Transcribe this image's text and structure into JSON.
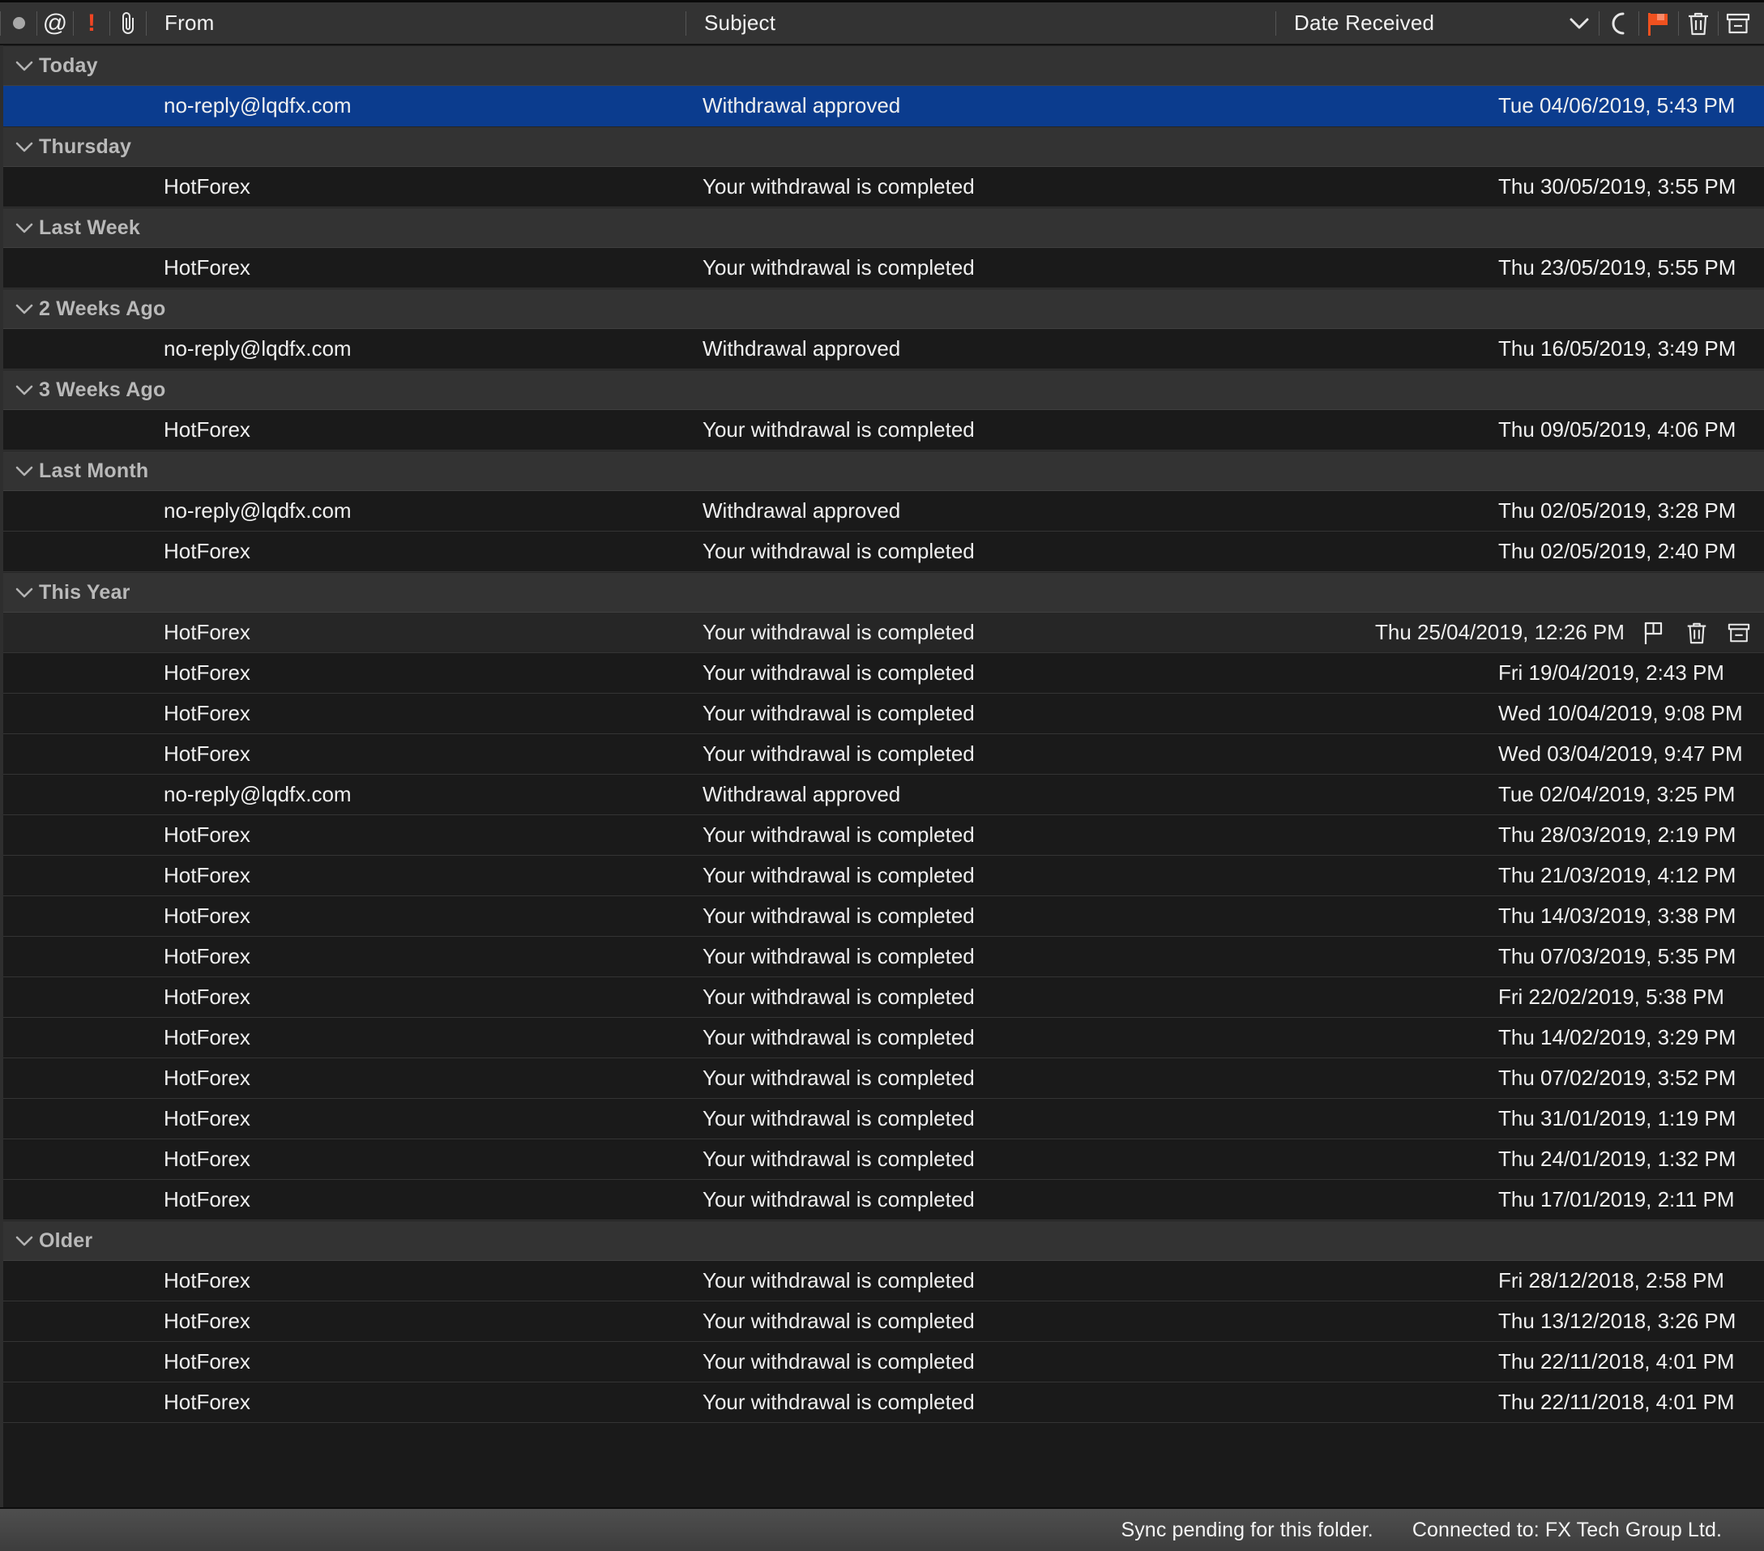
{
  "columns": {
    "icon_columns": [
      {
        "name": "unread-dot",
        "glyph": "●"
      },
      {
        "name": "mention-at",
        "glyph": "@"
      },
      {
        "name": "priority-exclaim",
        "glyph": "!"
      },
      {
        "name": "attachment-paperclip",
        "glyph": "🖇"
      }
    ],
    "from_label": "From",
    "subject_label": "Subject",
    "date_label": "Date Received"
  },
  "header_actions": [
    {
      "name": "chevron-down-icon",
      "label": "Sort direction"
    },
    {
      "name": "unread-moon-icon",
      "label": "Mark unread"
    },
    {
      "name": "flag-icon",
      "label": "Flag"
    },
    {
      "name": "trash-icon",
      "label": "Delete"
    },
    {
      "name": "archive-icon",
      "label": "Archive"
    }
  ],
  "colors": {
    "selection": "#0b3c8e",
    "flag_orange": "#f0511f",
    "priority_orange": "#ef4523",
    "group_header_bg": "#333333",
    "row_bg": "#1a1a1a",
    "hover_bg": "#262626",
    "statusbar_bg": "#474747"
  },
  "groups": [
    {
      "title": "Today",
      "rows": [
        {
          "from": "no-reply@lqdfx.com",
          "subject": "Withdrawal approved",
          "date": "Tue 04/06/2019, 5:43 PM",
          "selected": true,
          "hover": false
        }
      ]
    },
    {
      "title": "Thursday",
      "rows": [
        {
          "from": "HotForex",
          "subject": "Your withdrawal is completed",
          "date": "Thu 30/05/2019, 3:55 PM",
          "selected": false,
          "hover": false
        }
      ]
    },
    {
      "title": "Last Week",
      "rows": [
        {
          "from": "HotForex",
          "subject": "Your withdrawal is completed",
          "date": "Thu 23/05/2019, 5:55 PM",
          "selected": false,
          "hover": false
        }
      ]
    },
    {
      "title": "2 Weeks Ago",
      "rows": [
        {
          "from": "no-reply@lqdfx.com",
          "subject": "Withdrawal approved",
          "date": "Thu 16/05/2019, 3:49 PM",
          "selected": false,
          "hover": false
        }
      ]
    },
    {
      "title": "3 Weeks Ago",
      "rows": [
        {
          "from": "HotForex",
          "subject": "Your withdrawal is completed",
          "date": "Thu 09/05/2019, 4:06 PM",
          "selected": false,
          "hover": false
        }
      ]
    },
    {
      "title": "Last Month",
      "rows": [
        {
          "from": "no-reply@lqdfx.com",
          "subject": "Withdrawal approved",
          "date": "Thu 02/05/2019, 3:28 PM",
          "selected": false,
          "hover": false
        },
        {
          "from": "HotForex",
          "subject": "Your withdrawal is completed",
          "date": "Thu 02/05/2019, 2:40 PM",
          "selected": false,
          "hover": false
        }
      ]
    },
    {
      "title": "This Year",
      "rows": [
        {
          "from": "HotForex",
          "subject": "Your withdrawal is completed",
          "date": "Thu 25/04/2019, 12:26 PM",
          "selected": false,
          "hover": true
        },
        {
          "from": "HotForex",
          "subject": "Your withdrawal is completed",
          "date": "Fri 19/04/2019, 2:43 PM",
          "selected": false,
          "hover": false
        },
        {
          "from": "HotForex",
          "subject": "Your withdrawal is completed",
          "date": "Wed 10/04/2019, 9:08 PM",
          "selected": false,
          "hover": false
        },
        {
          "from": "HotForex",
          "subject": "Your withdrawal is completed",
          "date": "Wed 03/04/2019, 9:47 PM",
          "selected": false,
          "hover": false
        },
        {
          "from": "no-reply@lqdfx.com",
          "subject": "Withdrawal approved",
          "date": "Tue 02/04/2019, 3:25 PM",
          "selected": false,
          "hover": false
        },
        {
          "from": "HotForex",
          "subject": "Your withdrawal is completed",
          "date": "Thu 28/03/2019, 2:19 PM",
          "selected": false,
          "hover": false
        },
        {
          "from": "HotForex",
          "subject": "Your withdrawal is completed",
          "date": "Thu 21/03/2019, 4:12 PM",
          "selected": false,
          "hover": false
        },
        {
          "from": "HotForex",
          "subject": "Your withdrawal is completed",
          "date": "Thu 14/03/2019, 3:38 PM",
          "selected": false,
          "hover": false
        },
        {
          "from": "HotForex",
          "subject": "Your withdrawal is completed",
          "date": "Thu 07/03/2019, 5:35 PM",
          "selected": false,
          "hover": false
        },
        {
          "from": "HotForex",
          "subject": "Your withdrawal is completed",
          "date": "Fri 22/02/2019, 5:38 PM",
          "selected": false,
          "hover": false
        },
        {
          "from": "HotForex",
          "subject": "Your withdrawal is completed",
          "date": "Thu 14/02/2019, 3:29 PM",
          "selected": false,
          "hover": false
        },
        {
          "from": "HotForex",
          "subject": "Your withdrawal is completed",
          "date": "Thu 07/02/2019, 3:52 PM",
          "selected": false,
          "hover": false
        },
        {
          "from": "HotForex",
          "subject": "Your withdrawal is completed",
          "date": "Thu 31/01/2019, 1:19 PM",
          "selected": false,
          "hover": false
        },
        {
          "from": "HotForex",
          "subject": "Your withdrawal is completed",
          "date": "Thu 24/01/2019, 1:32 PM",
          "selected": false,
          "hover": false
        },
        {
          "from": "HotForex",
          "subject": "Your withdrawal is completed",
          "date": "Thu 17/01/2019, 2:11 PM",
          "selected": false,
          "hover": false
        }
      ]
    },
    {
      "title": "Older",
      "rows": [
        {
          "from": "HotForex",
          "subject": "Your withdrawal is completed",
          "date": "Fri 28/12/2018, 2:58 PM",
          "selected": false,
          "hover": false
        },
        {
          "from": "HotForex",
          "subject": "Your withdrawal is completed",
          "date": "Thu 13/12/2018, 3:26 PM",
          "selected": false,
          "hover": false
        },
        {
          "from": "HotForex",
          "subject": "Your withdrawal is completed",
          "date": "Thu 22/11/2018, 4:01 PM",
          "selected": false,
          "hover": false
        },
        {
          "from": "HotForex",
          "subject": "Your withdrawal is completed",
          "date": "Thu 22/11/2018, 4:01 PM",
          "selected": false,
          "hover": false
        }
      ]
    }
  ],
  "row_actions": [
    {
      "name": "flag-outline-icon",
      "label": "Flag"
    },
    {
      "name": "trash-icon",
      "label": "Delete"
    },
    {
      "name": "archive-icon",
      "label": "Archive"
    }
  ],
  "statusbar": {
    "sync_text": "Sync pending for this folder.",
    "connection_text": "Connected to: FX Tech Group Ltd."
  }
}
